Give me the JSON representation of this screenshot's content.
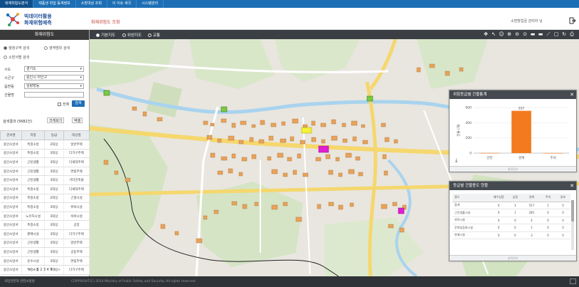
{
  "topnav": [
    "화재위험도분석",
    "제품생 위험 동계정보",
    "소방대상 조회",
    "이 이슈 새국",
    "시스템관리"
  ],
  "header": {
    "logo_line1": "빅데이터활용",
    "logo_line2": "화재위험예측",
    "page_title": "화재위험도 조회",
    "user_info": "소방방업금 관리자 님",
    "accent": "#1d6fb5"
  },
  "sidebar": {
    "title": "화재위험도",
    "radio_options": [
      "행정구역 검색",
      "영역범위 검색",
      "소방서별 검색"
    ],
    "fields": [
      {
        "label": "시도",
        "value": "경기도"
      },
      {
        "label": "시군구",
        "value": "용인시 처인구"
      },
      {
        "label": "읍면동",
        "value": "김량장동"
      },
      {
        "label": "건물명",
        "value": ""
      }
    ],
    "check_label": "전체",
    "search_button": "검색",
    "result_title": "검색결과 (5682건)",
    "btn_expand": "크게보기",
    "btn_excel": "엑셀",
    "table": {
      "headers": [
        "관서명",
        "지정",
        "등급",
        "대상명"
      ],
      "rows": [
        [
          "용인소방서",
          "특정소방",
          "2대상",
          "일반주택"
        ],
        [
          "용인소방서",
          "특정소방",
          "3대상",
          "다가구주택"
        ],
        [
          "용인소방서",
          "근린생활",
          "3대상",
          "다세대주택"
        ],
        [
          "용인소방서",
          "근린생활",
          "3대상",
          "연립주택"
        ],
        [
          "용인소방서",
          "근린생활",
          "3대상",
          "기타건축물"
        ],
        [
          "용인소방서",
          "특정소방",
          "2대상",
          "다세대주택"
        ],
        [
          "용인소방서",
          "특정소방",
          "2대상",
          "근생시설"
        ],
        [
          "용인소방서",
          "특정소방",
          "3대상",
          "위락시설"
        ],
        [
          "용인소방서",
          "노유자시설",
          "3대상",
          "숙박시설"
        ],
        [
          "용인소방서",
          "특정소방",
          "3대상",
          "공장"
        ],
        [
          "용인소방서",
          "판매시설",
          "3대상",
          "다가구주택"
        ],
        [
          "용인소방서",
          "근린생활",
          "3대상",
          "일반주택"
        ],
        [
          "용인소방서",
          "근린생활",
          "3대상",
          "공동주택"
        ],
        [
          "용인소방서",
          "운수시설",
          "3대상",
          "연립주택"
        ],
        [
          "용인소방서",
          "특정소방",
          "3대상",
          "다가구주택"
        ]
      ]
    },
    "pager": [
      "«",
      "‹",
      "1 2 3 4 5",
      "›",
      "»"
    ]
  },
  "maptool": {
    "options": [
      "기본지도",
      "위성지도",
      "교통"
    ]
  },
  "chart_panel": {
    "title": "위험등급별 건물통계",
    "footer": "범례정보",
    "chart_data": {
      "type": "bar",
      "categories": [
        "안전",
        "경계",
        "주의"
      ],
      "values": [
        2,
        557,
        1
      ],
      "data_labels": [
        "",
        "557",
        ""
      ],
      "ylim": [
        0,
        600
      ],
      "yticks": [
        0,
        200,
        400,
        600
      ],
      "ylabel": "건물 (개)",
      "color": "#f47a1f"
    }
  },
  "grade_panel": {
    "title": "등급별 건물용도 현황",
    "footer": "범례정보",
    "headers": [
      "용도",
      "매우심함",
      "심함",
      "경계",
      "주의",
      "양호"
    ],
    "rows": [
      [
        "합계",
        "0",
        "3",
        "557",
        "1",
        "0"
      ],
      [
        "근린생활시설",
        "0",
        "1",
        "285",
        "0",
        "0"
      ],
      [
        "위락시설",
        "0",
        "0",
        "4",
        "0",
        "0"
      ],
      [
        "문화및집회시설",
        "0",
        "0",
        "1",
        "0",
        "0"
      ],
      [
        "판매시설",
        "0",
        "0",
        "3",
        "0",
        "0"
      ]
    ]
  },
  "footer": {
    "org": "국민안전처 안전소방방",
    "copyright": "COPYRIGHT(C) 2014 Ministry of Public Safety and Security. All rights reserved."
  }
}
